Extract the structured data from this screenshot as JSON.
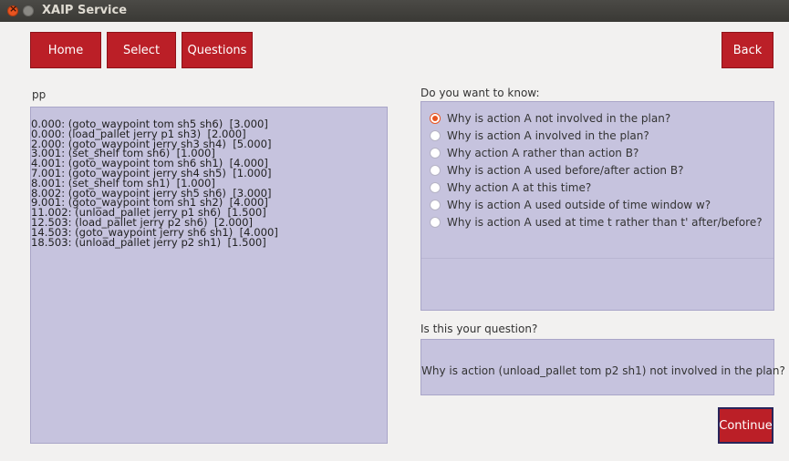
{
  "window": {
    "title": "XAIP Service"
  },
  "nav": {
    "home": "Home",
    "select": "Select",
    "questions": "Questions",
    "back": "Back"
  },
  "plan": {
    "label": "pp",
    "lines": [
      "0.000: (goto_waypoint tom sh5 sh6)  [3.000]",
      "0.000: (load_pallet jerry p1 sh3)  [2.000]",
      "2.000: (goto_waypoint jerry sh3 sh4)  [5.000]",
      "3.001: (set_shelf tom sh6)  [1.000]",
      "4.001: (goto_waypoint tom sh6 sh1)  [4.000]",
      "7.001: (goto_waypoint jerry sh4 sh5)  [1.000]",
      "8.001: (set_shelf tom sh1)  [1.000]",
      "8.002: (goto_waypoint jerry sh5 sh6)  [3.000]",
      "9.001: (goto_waypoint tom sh1 sh2)  [4.000]",
      "11.002: (unload_pallet jerry p1 sh6)  [1.500]",
      "12.503: (load_pallet jerry p2 sh6)  [2.000]",
      "14.503: (goto_waypoint jerry sh6 sh1)  [4.000]",
      "18.503: (unload_pallet jerry p2 sh1)  [1.500]"
    ]
  },
  "questions": {
    "label": "Do you want to know:",
    "selected_index": 0,
    "options": [
      "Why is action A not involved in the plan?",
      "Why is action A  involved in the plan?",
      "Why action A rather than action B?",
      "Why is action A used before/after action B?",
      "Why action A at this time?",
      "Why is action A used outside of time window w?",
      "Why is action A used at time t rather than t' after/before?"
    ]
  },
  "confirm": {
    "label": "Is this your question?",
    "text": "Why is action (unload_pallet tom p2 sh1) not involved in the plan?"
  },
  "continue_label": "Continue",
  "colors": {
    "button": "#bb1f27",
    "panel": "#c6c3de",
    "radio_selected": "#e95420"
  }
}
